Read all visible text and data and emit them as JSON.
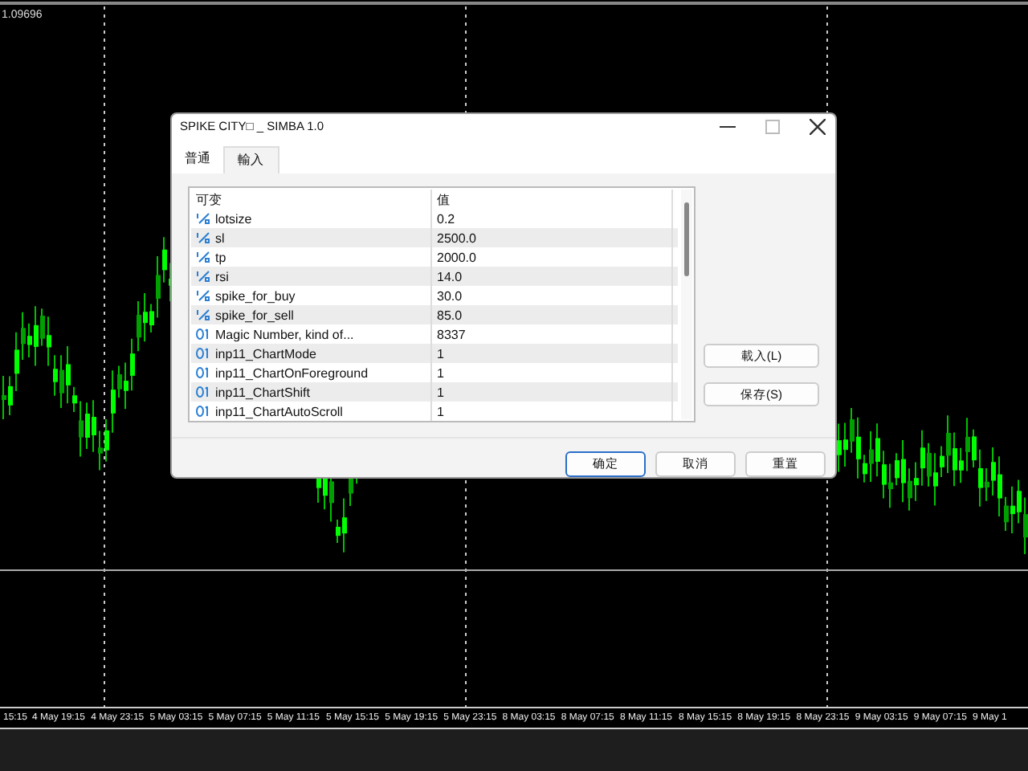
{
  "chart": {
    "price_label": "1.09696",
    "time_axis": [
      "15:15",
      "4 May 19:15",
      "4 May 23:15",
      "5 May 03:15",
      "5 May 07:15",
      "5 May 11:15",
      "5 May 15:15",
      "5 May 19:15",
      "5 May 23:15",
      "8 May 03:15",
      "8 May 07:15",
      "8 May 11:15",
      "8 May 15:15",
      "8 May 19:15",
      "8 May 23:15",
      "9 May 03:15",
      "9 May 07:15",
      "9 May 1"
    ]
  },
  "dialog": {
    "title": "SPIKE CITY□ _ SIMBA 1.0",
    "tabs": [
      {
        "label": "普通",
        "selected": false
      },
      {
        "label": "輸入",
        "selected": true
      }
    ],
    "table": {
      "columns": [
        "可变",
        "值"
      ],
      "rows": [
        {
          "kind": "double",
          "name": "lotsize",
          "value": "0.2"
        },
        {
          "kind": "double",
          "name": "sl",
          "value": "2500.0"
        },
        {
          "kind": "double",
          "name": "tp",
          "value": "2000.0"
        },
        {
          "kind": "double",
          "name": "rsi",
          "value": "14.0"
        },
        {
          "kind": "double",
          "name": "spike_for_buy",
          "value": "30.0"
        },
        {
          "kind": "double",
          "name": "spike_for_sell",
          "value": "85.0"
        },
        {
          "kind": "int",
          "name": "Magic Number, kind of...",
          "value": "8337"
        },
        {
          "kind": "int",
          "name": "inp11_ChartMode",
          "value": "1"
        },
        {
          "kind": "int",
          "name": "inp11_ChartOnForeground",
          "value": "1"
        },
        {
          "kind": "int",
          "name": "inp11_ChartShift",
          "value": "1"
        },
        {
          "kind": "int",
          "name": "inp11_ChartAutoScroll",
          "value": "1"
        }
      ]
    },
    "side_buttons": [
      "載入(L)",
      "保存(S)"
    ],
    "buttons": [
      {
        "label": "确定",
        "default": true
      },
      {
        "label": "取消",
        "default": false
      },
      {
        "label": "重置",
        "default": false
      }
    ]
  }
}
